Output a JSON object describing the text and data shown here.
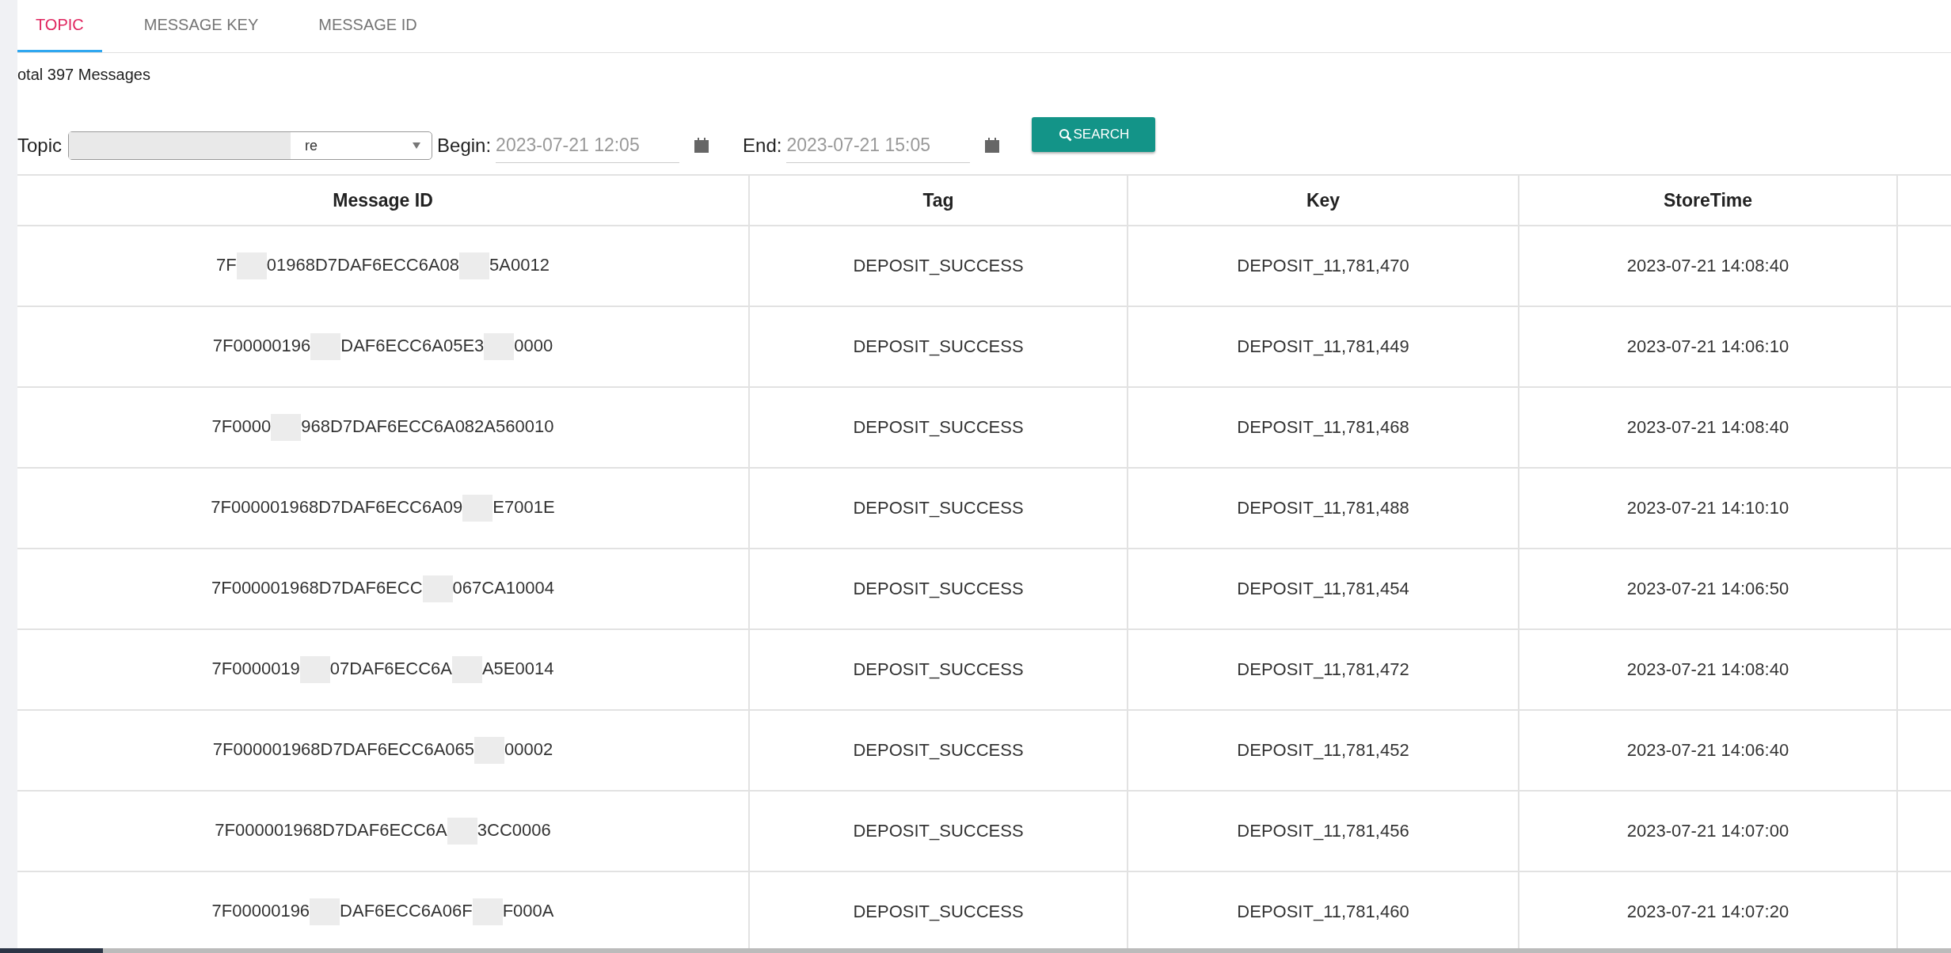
{
  "tabs": [
    {
      "label": "TOPIC",
      "selected": true
    },
    {
      "label": "MESSAGE KEY",
      "selected": false
    },
    {
      "label": "MESSAGE ID",
      "selected": false
    }
  ],
  "total": "otal 397 Messages",
  "filters": {
    "topic_label": "Topic",
    "topic_value": "re",
    "begin_label": "Begin:",
    "begin_value": "2023-07-21 12:05",
    "end_label": "End:",
    "end_value": "2023-07-21 15:05",
    "search_button": "SEARCH"
  },
  "table": {
    "columns": [
      "Message ID",
      "Tag",
      "Key",
      "StoreTime"
    ],
    "rows": [
      {
        "message_id_parts": [
          "7F",
          "01968D7DAF6ECC6A08",
          "5A0012"
        ],
        "tag": "DEPOSIT_SUCCESS",
        "key": "DEPOSIT_11,781,470",
        "store_time": "2023-07-21 14:08:40"
      },
      {
        "message_id_parts": [
          "7F00000196",
          "DAF6ECC6A05E3",
          "0000"
        ],
        "tag": "DEPOSIT_SUCCESS",
        "key": "DEPOSIT_11,781,449",
        "store_time": "2023-07-21 14:06:10"
      },
      {
        "message_id_parts": [
          "7F0000",
          "968D7DAF6ECC6A082A560010"
        ],
        "tag": "DEPOSIT_SUCCESS",
        "key": "DEPOSIT_11,781,468",
        "store_time": "2023-07-21 14:08:40"
      },
      {
        "message_id_parts": [
          "7F000001968D7DAF6ECC6A09",
          "E7001E"
        ],
        "tag": "DEPOSIT_SUCCESS",
        "key": "DEPOSIT_11,781,488",
        "store_time": "2023-07-21 14:10:10"
      },
      {
        "message_id_parts": [
          "7F000001968D7DAF6ECC",
          "067CA10004"
        ],
        "tag": "DEPOSIT_SUCCESS",
        "key": "DEPOSIT_11,781,454",
        "store_time": "2023-07-21 14:06:50"
      },
      {
        "message_id_parts": [
          "7F0000019",
          "07DAF6ECC6A",
          "A5E0014"
        ],
        "tag": "DEPOSIT_SUCCESS",
        "key": "DEPOSIT_11,781,472",
        "store_time": "2023-07-21 14:08:40"
      },
      {
        "message_id_parts": [
          "7F000001968D7DAF6ECC6A065",
          "00002"
        ],
        "tag": "DEPOSIT_SUCCESS",
        "key": "DEPOSIT_11,781,452",
        "store_time": "2023-07-21 14:06:40"
      },
      {
        "message_id_parts": [
          "7F000001968D7DAF6ECC6A",
          "3CC0006"
        ],
        "tag": "DEPOSIT_SUCCESS",
        "key": "DEPOSIT_11,781,456",
        "store_time": "2023-07-21 14:07:00"
      },
      {
        "message_id_parts": [
          "7F00000196",
          "DAF6ECC6A06F",
          "F000A"
        ],
        "tag": "DEPOSIT_SUCCESS",
        "key": "DEPOSIT_11,781,460",
        "store_time": "2023-07-21 14:07:20"
      }
    ]
  }
}
